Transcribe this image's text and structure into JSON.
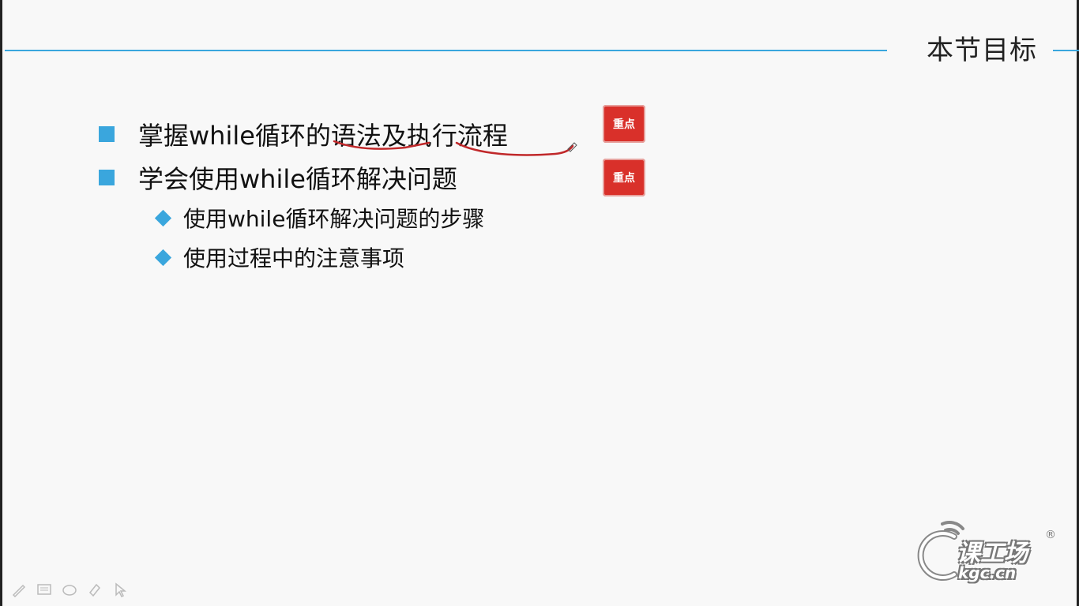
{
  "slide": {
    "title": "本节目标",
    "items": [
      {
        "text": "掌握while循环的语法及执行流程",
        "badge": "重点"
      },
      {
        "text": "学会使用while循环解决问题",
        "badge": "重点"
      }
    ],
    "subitems": [
      {
        "text": "使用while循环解决问题的步骤"
      },
      {
        "text": "使用过程中的注意事项"
      }
    ]
  },
  "logo": {
    "name": "课工场",
    "site": "kgc.cn",
    "registered": "®"
  },
  "toolbar": {
    "icons": [
      "pen-icon",
      "screen-icon",
      "eraser-icon",
      "highlighter-icon",
      "pointer-icon"
    ]
  },
  "colors": {
    "accent": "#3aa6dd",
    "stamp": "#d9302a",
    "annotation": "#c0282a"
  }
}
